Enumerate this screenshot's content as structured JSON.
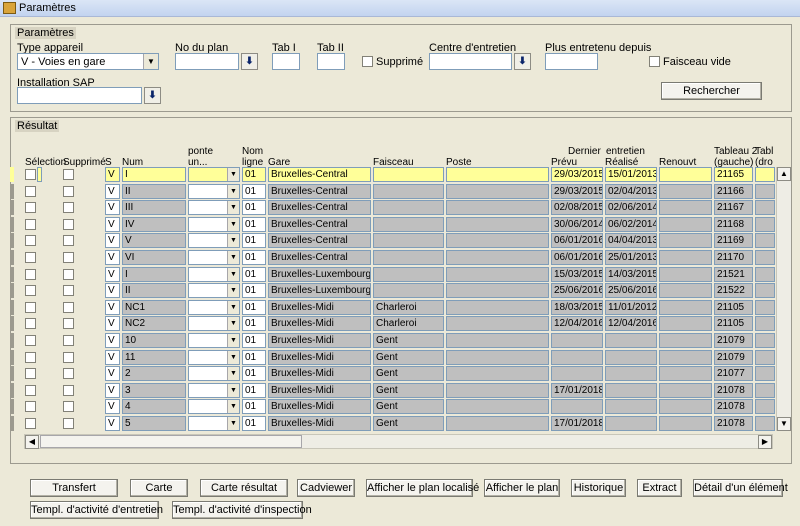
{
  "window": {
    "title": "Paramètres"
  },
  "params": {
    "group_title": "Paramètres",
    "type_appareil_label": "Type appareil",
    "type_appareil_value": "V - Voies en gare",
    "no_plan_label": "No du plan",
    "tab1_label": "Tab I",
    "tab2_label": "Tab II",
    "supprime_label": "Supprimé",
    "centre_label": "Centre d'entretien",
    "plus_entretenu_label": "Plus entretenu depuis",
    "faisceau_vide_label": "Faisceau vide",
    "installation_sap_label": "Installation SAP",
    "search_button": "Rechercher"
  },
  "result": {
    "group_title": "Résultat",
    "columns": {
      "selection": "Sélection",
      "supprime": "Supprimé",
      "s": "S",
      "num": "Num",
      "ponte_1": "ponte",
      "ponte_2": "un...",
      "nomligne_1": "Nom",
      "nomligne_2": "ligne",
      "gare": "Gare",
      "faisceau": "Faisceau",
      "poste": "Poste",
      "dernier_1": "Dernier",
      "dernier_2": "Prévu",
      "entretien_1": "entretien",
      "entretien_2": "Réalisé",
      "renouvt": "Renouvt",
      "tableau2_1": "Tableau 2",
      "tableau2_2": "(gauche)",
      "tab3_1": "Tabl",
      "tab3_2": "(dro"
    },
    "rows": [
      {
        "s": "V",
        "num": "I",
        "ligne": "01",
        "gare": "Bruxelles-Central",
        "faisceau": "",
        "poste": "",
        "prevu": "29/03/2015",
        "realise": "15/01/2013",
        "renouvt": "",
        "tableau2": "21165"
      },
      {
        "s": "V",
        "num": "II",
        "ligne": "01",
        "gare": "Bruxelles-Central",
        "faisceau": "",
        "poste": "",
        "prevu": "29/03/2015",
        "realise": "02/04/2013",
        "renouvt": "",
        "tableau2": "21166"
      },
      {
        "s": "V",
        "num": "III",
        "ligne": "01",
        "gare": "Bruxelles-Central",
        "faisceau": "",
        "poste": "",
        "prevu": "02/08/2015",
        "realise": "02/06/2014",
        "renouvt": "",
        "tableau2": "21167"
      },
      {
        "s": "V",
        "num": "IV",
        "ligne": "01",
        "gare": "Bruxelles-Central",
        "faisceau": "",
        "poste": "",
        "prevu": "30/06/2014",
        "realise": "06/02/2014",
        "renouvt": "",
        "tableau2": "21168"
      },
      {
        "s": "V",
        "num": "V",
        "ligne": "01",
        "gare": "Bruxelles-Central",
        "faisceau": "",
        "poste": "",
        "prevu": "06/01/2016",
        "realise": "04/04/2013",
        "renouvt": "",
        "tableau2": "21169"
      },
      {
        "s": "V",
        "num": "VI",
        "ligne": "01",
        "gare": "Bruxelles-Central",
        "faisceau": "",
        "poste": "",
        "prevu": "06/01/2016",
        "realise": "25/01/2013",
        "renouvt": "",
        "tableau2": "21170"
      },
      {
        "s": "V",
        "num": "I",
        "ligne": "01",
        "gare": "Bruxelles-Luxembourg",
        "faisceau": "",
        "poste": "",
        "prevu": "15/03/2015",
        "realise": "14/03/2015",
        "renouvt": "",
        "tableau2": "21521"
      },
      {
        "s": "V",
        "num": "II",
        "ligne": "01",
        "gare": "Bruxelles-Luxembourg",
        "faisceau": "",
        "poste": "",
        "prevu": "25/06/2016",
        "realise": "25/06/2016",
        "renouvt": "",
        "tableau2": "21522"
      },
      {
        "s": "V",
        "num": "NC1",
        "ligne": "01",
        "gare": "Bruxelles-Midi",
        "faisceau": "Charleroi",
        "poste": "",
        "prevu": "18/03/2015",
        "realise": "11/01/2012",
        "renouvt": "",
        "tableau2": "21105"
      },
      {
        "s": "V",
        "num": "NC2",
        "ligne": "01",
        "gare": "Bruxelles-Midi",
        "faisceau": "Charleroi",
        "poste": "",
        "prevu": "12/04/2016",
        "realise": "12/04/2016",
        "renouvt": "",
        "tableau2": "21105"
      },
      {
        "s": "V",
        "num": "10",
        "ligne": "01",
        "gare": "Bruxelles-Midi",
        "faisceau": "Gent",
        "poste": "",
        "prevu": "",
        "realise": "",
        "renouvt": "",
        "tableau2": "21079"
      },
      {
        "s": "V",
        "num": "11",
        "ligne": "01",
        "gare": "Bruxelles-Midi",
        "faisceau": "Gent",
        "poste": "",
        "prevu": "",
        "realise": "",
        "renouvt": "",
        "tableau2": "21079"
      },
      {
        "s": "V",
        "num": "2",
        "ligne": "01",
        "gare": "Bruxelles-Midi",
        "faisceau": "Gent",
        "poste": "",
        "prevu": "",
        "realise": "",
        "renouvt": "",
        "tableau2": "21077"
      },
      {
        "s": "V",
        "num": "3",
        "ligne": "01",
        "gare": "Bruxelles-Midi",
        "faisceau": "Gent",
        "poste": "",
        "prevu": "17/01/2018",
        "realise": "",
        "renouvt": "",
        "tableau2": "21078"
      },
      {
        "s": "V",
        "num": "4",
        "ligne": "01",
        "gare": "Bruxelles-Midi",
        "faisceau": "Gent",
        "poste": "",
        "prevu": "",
        "realise": "",
        "renouvt": "",
        "tableau2": "21078"
      },
      {
        "s": "V",
        "num": "5",
        "ligne": "01",
        "gare": "Bruxelles-Midi",
        "faisceau": "Gent",
        "poste": "",
        "prevu": "17/01/2018",
        "realise": "",
        "renouvt": "",
        "tableau2": "21078"
      }
    ]
  },
  "buttons": {
    "transfert": "Transfert",
    "carte": "Carte",
    "carte_resultat": "Carte résultat",
    "cadviewer": "Cadviewer",
    "afficher_plan_localise": "Afficher le plan localisé",
    "afficher_plan": "Afficher le plan",
    "historique": "Historique",
    "extract": "Extract",
    "detail_element": "Détail d'un élément",
    "templ_entretien": "Templ. d'activité d'entretien",
    "templ_inspection": "Templ. d'activité d'inspection"
  }
}
